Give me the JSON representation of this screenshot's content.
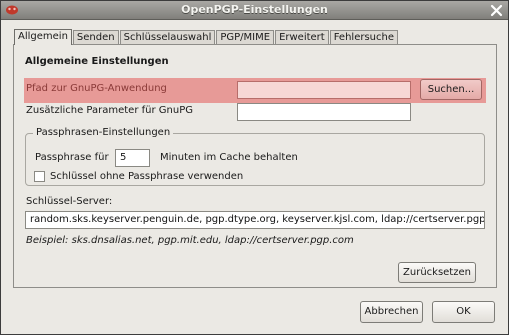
{
  "window": {
    "title": "OpenPGP-Einstellungen"
  },
  "tabs": [
    {
      "label": "Allgemein",
      "active": true
    },
    {
      "label": "Senden",
      "active": false
    },
    {
      "label": "Schlüsselauswahl",
      "active": false
    },
    {
      "label": "PGP/MIME",
      "active": false
    },
    {
      "label": "Erweitert",
      "active": false
    },
    {
      "label": "Fehlersuche",
      "active": false
    }
  ],
  "general": {
    "section_title": "Allgemeine Einstellungen",
    "gpg_path_label": "Pfad zur GnuPG-Anwendung",
    "gpg_path_value": "",
    "browse_button": "Suchen...",
    "extra_params_label": "Zusätzliche Parameter für GnuPG",
    "extra_params_value": ""
  },
  "passphrase": {
    "group_title": "Passphrasen-Einstellungen",
    "cache_label_before": "Passphrase für",
    "cache_minutes": "5",
    "cache_label_after": "Minuten im Cache behalten",
    "no_passphrase_label": "Schlüssel ohne Passphrase verwenden",
    "no_passphrase_checked": false
  },
  "keyserver": {
    "label": "Schlüssel-Server:",
    "value": "random.sks.keyserver.penguin.de, pgp.dtype.org, keyserver.kjsl.com, ldap://certserver.pgp.com",
    "example": "Beispiel: sks.dnsalias.net, pgp.mit.edu, ldap://certserver.pgp.com"
  },
  "buttons": {
    "reset": "Zurücksetzen",
    "cancel": "Abbrechen",
    "ok": "OK"
  },
  "colors": {
    "highlight": "#e79a97",
    "titlebar": "#8f8e8a"
  },
  "icons": {
    "app": "openpgp-icon",
    "close": "close-icon"
  }
}
